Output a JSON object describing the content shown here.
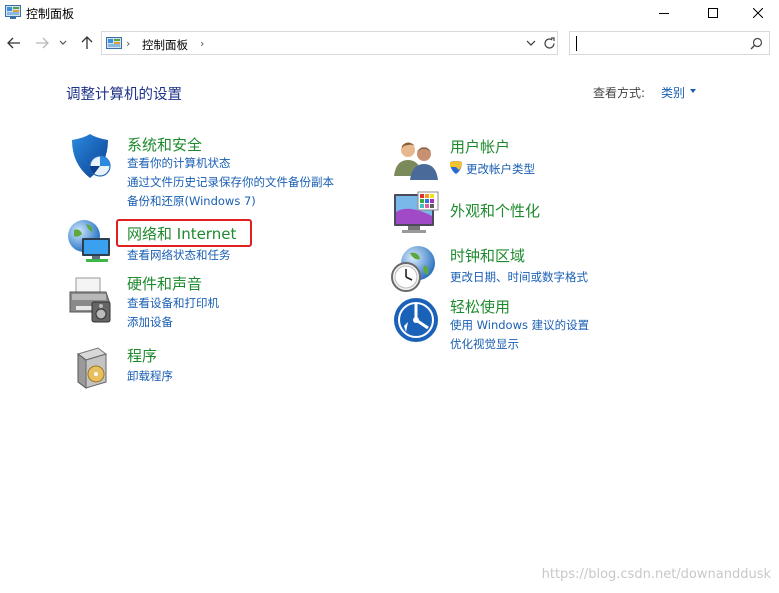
{
  "window": {
    "title": "控制面板",
    "icons": {
      "app": "control-panel-icon",
      "minimize": "minimize-icon",
      "maximize": "maximize-icon",
      "close": "close-icon"
    }
  },
  "navigation": {
    "address": {
      "crumb": "控制面板",
      "separator_left": "›",
      "separator_right": "›"
    },
    "search": {
      "placeholder": ""
    }
  },
  "header": {
    "title": "调整计算机的设置",
    "view_by_label": "查看方式:",
    "view_by_value": "类别"
  },
  "categories_left": [
    {
      "title": "系统和安全",
      "icon": "shield-icon",
      "links": [
        "查看你的计算机状态",
        "通过文件历史记录保存你的文件备份副本",
        "备份和还原(Windows 7)"
      ]
    },
    {
      "title": "网络和 Internet",
      "icon": "network-globe-icon",
      "links": [
        "查看网络状态和任务"
      ]
    },
    {
      "title": "硬件和声音",
      "icon": "printer-icon",
      "links": [
        "查看设备和打印机",
        "添加设备"
      ]
    },
    {
      "title": "程序",
      "icon": "programs-box-icon",
      "links": [
        "卸载程序"
      ]
    }
  ],
  "categories_right": [
    {
      "title": "用户帐户",
      "icon": "users-icon",
      "links": [
        "更改帐户类型"
      ]
    },
    {
      "title": "外观和个性化",
      "icon": "monitor-palette-icon",
      "links": []
    },
    {
      "title": "时钟和区域",
      "icon": "clock-globe-icon",
      "links": [
        "更改日期、时间或数字格式"
      ]
    },
    {
      "title": "轻松使用",
      "icon": "ease-of-access-icon",
      "links": [
        "使用 Windows 建议的设置",
        "优化视觉显示"
      ]
    }
  ],
  "colors": {
    "title_blue": "#1e3287",
    "link_blue": "#1a5fb4",
    "category_green": "#1e8a2e",
    "highlight_red": "#e02020"
  },
  "watermark": "https://blog.csdn.net/downanddusk"
}
